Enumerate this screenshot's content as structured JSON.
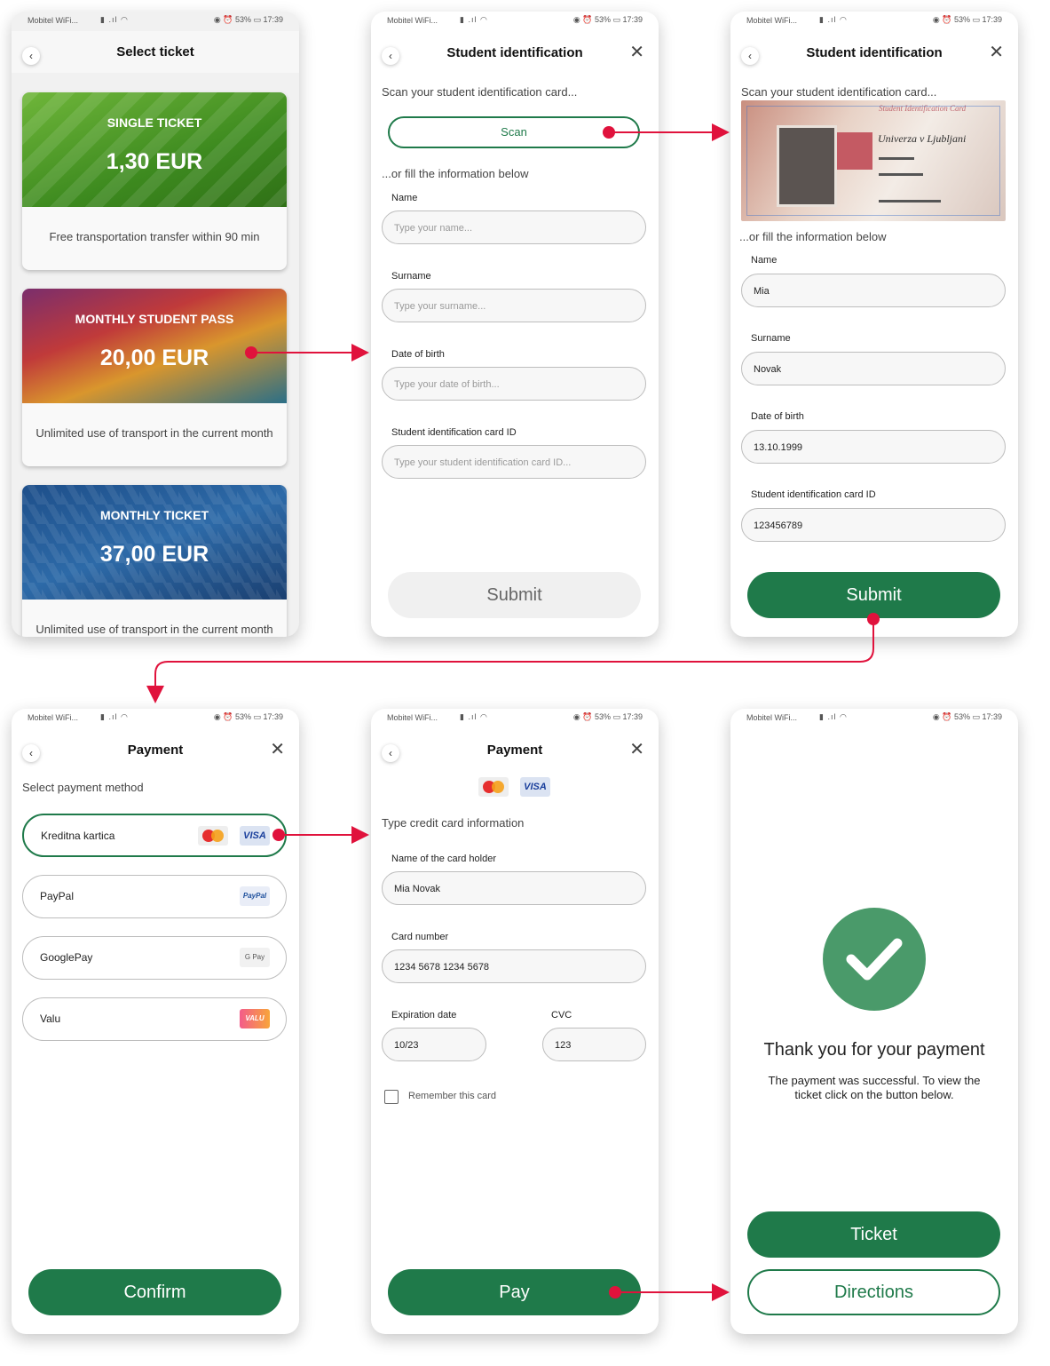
{
  "status": {
    "carrier": "Mobitel WiFi...",
    "battery": "53%",
    "time": "17:39"
  },
  "screen1": {
    "title": "Select ticket",
    "tickets": [
      {
        "name": "SINGLE TICKET",
        "price": "1,30 EUR",
        "desc": "Free transportation transfer within 90 min"
      },
      {
        "name": "MONTHLY STUDENT PASS",
        "price": "20,00 EUR",
        "desc": "Unlimited use of transport in the current month"
      },
      {
        "name": "MONTHLY TICKET",
        "price": "37,00 EUR",
        "desc": "Unlimited use of transport in the current month"
      }
    ]
  },
  "screen2": {
    "title": "Student identification",
    "scan_prompt": "Scan your student identification card...",
    "scan_button": "Scan",
    "or_fill": "...or fill the information below",
    "fields": [
      {
        "label": "Name",
        "placeholder": "Type your name..."
      },
      {
        "label": "Surname",
        "placeholder": "Type your surname..."
      },
      {
        "label": "Date of birth",
        "placeholder": "Type your date of birth..."
      },
      {
        "label": "Student identification card ID",
        "placeholder": "Type your student identification card ID..."
      }
    ],
    "submit": "Submit"
  },
  "screen3": {
    "title": "Student identification",
    "scan_prompt": "Scan your student identification card...",
    "card_university": "Univerza v Ljubljani",
    "card_title": "Student Identification Card",
    "or_fill": "...or fill the information below",
    "fields": [
      {
        "label": "Name",
        "value": "Mia"
      },
      {
        "label": "Surname",
        "value": "Novak"
      },
      {
        "label": "Date of birth",
        "value": "13.10.1999"
      },
      {
        "label": "Student identification card ID",
        "value": "123456789"
      }
    ],
    "submit": "Submit"
  },
  "screen4": {
    "title": "Payment",
    "select_label": "Select payment method",
    "options": [
      {
        "name": "Kreditna kartica"
      },
      {
        "name": "PayPal",
        "logo": "PayPal"
      },
      {
        "name": "GooglePay",
        "logo": "G Pay"
      },
      {
        "name": "Valu",
        "logo": "VALU"
      }
    ],
    "confirm": "Confirm"
  },
  "screen5": {
    "title": "Payment",
    "visa_logo": "VISA",
    "type_label": "Type credit card information",
    "holder_label": "Name of the card holder",
    "holder_value": "Mia Novak",
    "number_label": "Card number",
    "number_value": "1234 5678 1234 5678",
    "exp_label": "Expiration date",
    "exp_value": "10/23",
    "cvc_label": "CVC",
    "cvc_value": "123",
    "remember": "Remember this card",
    "pay": "Pay"
  },
  "screen6": {
    "thanks": "Thank you for your payment",
    "message": "The payment was successful. To view the ticket click on the button below.",
    "ticket_button": "Ticket",
    "directions_button": "Directions"
  },
  "colors": {
    "green": "#1f7a4a",
    "arrow": "#e0123c"
  }
}
